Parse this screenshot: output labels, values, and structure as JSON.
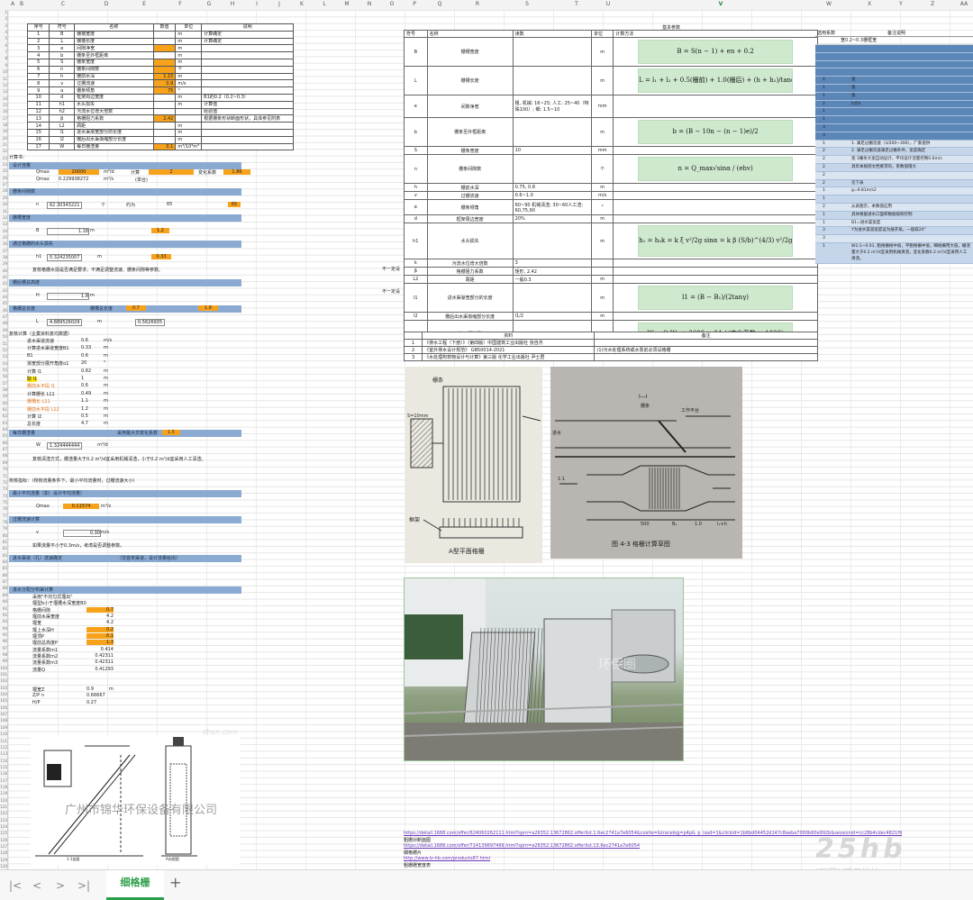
{
  "sheet": {
    "columns": [
      "A",
      "B",
      "C",
      "D",
      "E",
      "F",
      "G",
      "H",
      "I",
      "J",
      "K",
      "L",
      "M",
      "N",
      "O",
      "P",
      "Q",
      "R",
      "S",
      "T",
      "U",
      "V",
      "W",
      "X",
      "Y",
      "Z",
      "AA"
    ],
    "selected_column": "V",
    "active_tab": "细格栅",
    "add_tab": "+"
  },
  "params_table": {
    "headers": [
      "序号",
      "符号",
      "名称",
      "数值",
      "单位",
      "说明"
    ],
    "rows": [
      [
        "1",
        "B",
        "栅槽宽度",
        "",
        "m",
        "计算确定"
      ],
      [
        "2",
        "L",
        "栅槽长度",
        "",
        "m",
        "计算确定"
      ],
      [
        "3",
        "e",
        "间隙净宽",
        "",
        "m",
        ""
      ],
      [
        "4",
        "b",
        "栅条至外框距离",
        "",
        "m",
        ""
      ],
      [
        "5",
        "S",
        "栅条宽度",
        "",
        "m",
        ""
      ],
      [
        "6",
        "n",
        "栅条间隙数",
        "",
        "个",
        ""
      ],
      [
        "7",
        "h",
        "栅前水深",
        "1.15",
        "m",
        ""
      ],
      [
        "8",
        "v",
        "过栅流速",
        "0.9",
        "m/s",
        ""
      ],
      [
        "9",
        "α",
        "栅条倾角",
        "75",
        "°",
        ""
      ],
      [
        "10",
        "d",
        "框架周边宽度",
        "",
        "m",
        "B1的0.2（0.2~0.3）"
      ],
      [
        "11",
        "h1",
        "水头损失",
        "",
        "m",
        "计算值"
      ],
      [
        "12",
        "h2",
        "污流水位增大倍数",
        "",
        "",
        "经验值"
      ],
      [
        "13",
        "β",
        "格栅阻力系数",
        "2.42",
        "",
        "根据栅条形状断面形状，具体参见附表"
      ],
      [
        "14",
        "L2",
        "屑距",
        "",
        "m",
        ""
      ],
      [
        "15",
        "l1",
        "进水渠渐宽部分的长度",
        "",
        "m",
        ""
      ],
      [
        "16",
        "l2",
        "栅后出水渠渐缩部分长度",
        "",
        "m",
        ""
      ],
      [
        "17",
        "W",
        "每日栅渣量",
        "0.1",
        "m³/10³m³",
        ""
      ]
    ]
  },
  "left_calc": {
    "title": "计算书：",
    "s1": "设计流量",
    "q_max_label": "Qmax",
    "q_max_value": "20000",
    "q_max_unit": "m³/d",
    "q_flow_label": "计算",
    "q_flow_value": "2",
    "k_label": "变化系数",
    "k_value": "1.86",
    "q2_label": "Qmax",
    "q2_value": "0.229938272",
    "q2_unit": "m³/s",
    "q2_note": "(单台)",
    "s2": "栅条间隙数",
    "n_label": "n",
    "n_value": "62.30343221",
    "n_unit": "个",
    "n_note": "约为",
    "n_round": "65",
    "n_final": "65",
    "s3": "栅槽宽度",
    "b_label": "B",
    "b_value": "1.18",
    "b_unit": "m",
    "b_round": "1.2",
    "s4": "通过格栅的水头损失",
    "h1_label": "h1",
    "h1_value": "0.324235007",
    "h1_unit": "m",
    "h1_round": "0.33",
    "h1_note": "复核格栅水损是否满足要求，不满足调整流速、栅条间隙等参数。",
    "s5": "栅后槽总高度",
    "H_label": "H",
    "H_value": "1.8",
    "H_unit": "m",
    "s6": "格栅总长度",
    "len_label": "栅槽总长度",
    "len_value1": "0.7",
    "len_value2": "1.8",
    "L_label": "L",
    "L_value": "4.889526029",
    "L_unit": "m",
    "L_value2": "0.5626935"
  },
  "left_calc2": {
    "title": "复核计算（企業资料复均数据）",
    "lines": [
      [
        "进水渠道流速",
        "0.6",
        "m/s"
      ],
      [
        "计算进水渠道宽度B1",
        "0.33",
        "m"
      ],
      [
        "B1",
        "0.6",
        "m"
      ],
      [
        "渐宽部分展开角度α1",
        "20",
        "°"
      ],
      [
        "计算 l1",
        "0.82",
        "m"
      ],
      [
        "取 l1",
        "1",
        "m"
      ],
      [
        "栅前水平段 l1",
        "0.6",
        "m"
      ],
      [
        "计算栅长 L11",
        "0.49",
        "m"
      ],
      [
        "栅槽长 L11",
        "1.1",
        "m"
      ],
      [
        "栅前水平段 L12",
        "1.2",
        "m"
      ],
      [
        "计算 l2",
        "0.5",
        "m"
      ],
      [
        "总长度",
        "4.7",
        "m"
      ]
    ],
    "s7": "每日栅渣量",
    "w_label": "W",
    "w_value": "1.324444444",
    "w_unit": "m³/d",
    "w_note": "采用最大日变化系数",
    "w_k": "1.5",
    "w_text": "复核清渣方式，栅渣量大于0.2 m³/d宜采用机械清渣，小于0.2 m³/d宜采用人工清渣。",
    "check_text": "校核指标：（校核流量条件下，最小平均流量时，过栅流速大小）",
    "s8": "最小平均流量（如：设计平均流量）",
    "qmin_label": "Qmax",
    "qmin_value": "0.11574",
    "qmin_unit": "m³/s",
    "s9": "过栅流速计算",
    "v_label": "v",
    "v_value": "0.30",
    "v_unit": "m/s",
    "v_note": "如果流量不小于0.3m/s，考虑是否调整参数。",
    "s10": "进水渠道（孔）流速确定",
    "s10_note": "（非首末渠道，设计流量给出）",
    "s11": "进水分配分布渠计算",
    "s11_lines": [
      [
        "采用\"不均匀式堰出\"",
        ""
      ],
      [
        "堰型b小于堰槽水深宽度B0",
        ""
      ],
      [
        "格栅间隙",
        "0.7"
      ],
      [
        "堰前水渠宽度",
        "4.2"
      ],
      [
        "堰宽",
        "4.2"
      ],
      [
        "堰上水深H",
        "0.2"
      ],
      [
        "堰顶P",
        "0.1"
      ],
      [
        "堰前总高度P",
        "1.3"
      ],
      [
        "流量系数m1",
        "0.414"
      ],
      [
        "流量系数m2",
        "0.42311"
      ],
      [
        "流量系数m3",
        "0.42311"
      ],
      [
        "流量Q",
        "0.41293"
      ]
    ],
    "end_lines": [
      [
        "堰宽Z",
        "0.9",
        "m"
      ],
      [
        "Z/P n",
        "0.66667",
        ""
      ],
      [
        "H/P",
        "0.27",
        ""
      ]
    ]
  },
  "basic_params": {
    "title": "基本参数",
    "headers": [
      "符号",
      "名称",
      "读数",
      "单位",
      "计算方法"
    ],
    "rows": [
      {
        "sym": "B",
        "name": "栅槽宽度",
        "val": "",
        "unit": "m",
        "formula": "B = S(n − 1) + en + 0.2"
      },
      {
        "sym": "L",
        "name": "栅槽长度",
        "val": "",
        "unit": "m",
        "formula": "L = l₁ + l₂ + 0.5(栅前) + 1.0(栅后) + (h + h₂)/tanα"
      },
      {
        "sym": "e",
        "name": "间隙净宽",
        "val": "粗, 机械: 16~25; 人工: 25~40（特殊100）; 细: 1.5~10",
        "unit": "mm",
        "formula": ""
      },
      {
        "sym": "b",
        "name": "栅条至外框距离",
        "val": "",
        "unit": "m",
        "formula": "b = (B − 10n − (n − 1)e)/2"
      },
      {
        "sym": "S",
        "name": "栅条宽度",
        "val": "10",
        "unit": "mm",
        "formula": ""
      },
      {
        "sym": "n",
        "name": "栅条间隙数",
        "val": "",
        "unit": "个",
        "formula": "n = Q_max√sinα / (ehv)"
      },
      {
        "sym": "h",
        "name": "栅前水深",
        "val": "0.75, 0.8",
        "unit": "m",
        "formula": ""
      },
      {
        "sym": "v",
        "name": "过栅流速",
        "val": "0.6~1.0",
        "unit": "m/s",
        "formula": ""
      },
      {
        "sym": "α",
        "name": "栅条倾角",
        "val": "60~90 机械清渣; 30~60人工渣; 60,75,90",
        "unit": "°",
        "formula": ""
      },
      {
        "sym": "d",
        "name": "框架周边宽度",
        "val": "20%",
        "unit": "m",
        "formula": ""
      },
      {
        "sym": "h1",
        "name": "水头损失",
        "val": "",
        "unit": "m",
        "formula": "h₁ = h₀k = k ξ v²/2g sinα = k β (S/b)^(4/3) v²/2g sinα"
      },
      {
        "sym": "k",
        "name": "污流水位增大倍数",
        "val": "3",
        "unit": "",
        "formula": ""
      },
      {
        "sym": "β",
        "name": "格栅阻力系数",
        "val": "矩形, 2.42",
        "unit": "",
        "formula": ""
      },
      {
        "sym": "L2",
        "name": "屑距",
        "val": "一般0.3",
        "unit": "m",
        "formula": ""
      },
      {
        "sym": "l1",
        "name": "进水渠渐宽部分的长度",
        "val": "",
        "unit": "m",
        "formula": "l1 = (B − B₁)/(2tanγ)"
      },
      {
        "sym": "l2",
        "name": "栅后出水渠渐缩部分长度",
        "val": "l1/2",
        "unit": "m",
        "formula": ""
      },
      {
        "sym": "W",
        "name": "每日栅渣量",
        "val": "",
        "unit": "m³/d",
        "formula": "W = Q W₁ × 3600 × 24 / (变化系数 × 1000)"
      }
    ],
    "side_notes": [
      "不一定设",
      "不一定设"
    ]
  },
  "right_notes": {
    "headers": [
      "选用系数",
      "备注说明"
    ],
    "first": "宽0.2~0.3栅框宽",
    "vals": [
      "2",
      "2",
      "2",
      "2",
      "2",
      "1",
      "1",
      "2",
      "1",
      "1",
      "3",
      "3",
      "1"
    ],
    "notes": [
      "",
      "",
      "",
      "",
      "宽",
      "宽",
      "宽",
      "b大b",
      "",
      "",
      "",
      "",
      "1. 满足过栅流速（3/200~300），厂家提供",
      "2. 满足过栅流速满足过栅条件，宽度确定",
      "宽 1栅条大宽自动设计，平均设计流量控制0.6m/s",
      "具有本规则文档要求的，系数值增大",
      "",
      "见下表",
      "g=9.81m/s2",
      "",
      "从表图示，本数值应用",
      "具体根据进水口面积数据按照控制",
      "B1=进水渠宽度",
      "Y为进水渠道宽度设为展开角，一般取20°",
      "",
      "W1:1~0.01, 粗格栅格中值，平粗格栅中值，细格栅用大值，栅渣量大于0.2 m³/d宜采用机械清渣，变化系数0.2 m³/d宜采用人工清渣。"
    ]
  },
  "refs_table": {
    "headers": [
      "资料",
      "备注"
    ],
    "rows": [
      [
        "1",
        "《排水工程（下册）》（第四版）中国建筑工业出版社 张自杰",
        ""
      ],
      [
        "2",
        "《室外排水设计规范》 GB50014-2021",
        "(1)污水处理系统或水泵前必须设格栅"
      ],
      [
        "3",
        "《水处理构筑物设计与计算》第三版 化学工业出版社 尹士君",
        ""
      ]
    ]
  },
  "figures": {
    "fig_a_caption": "A型平面格栅",
    "fig_a_labels": [
      "栅条",
      "S=10mm",
      "框架"
    ],
    "fig_b_caption": "图 4-3   格栅计算草图",
    "fig_b_labels": [
      "I—I",
      "工作平台",
      "栅条",
      "进水",
      "1:1",
      "500",
      "B₁",
      "1.0",
      "l₁+h"
    ],
    "photo_watermark": "环保圈",
    "drawing_company": "广州市锦华环保设备有限公司",
    "drawing_label1": "1-1剖面",
    "drawing_label2": "A向视图",
    "drawing_watermark": "zhan.com"
  },
  "links": [
    "https://detail.1688.com/offer/624060262111.html?spm=a26352.13672862.offerlist.1.6ec2741a7e6054&cosite=&tracelog=p4p&_p_isad=1&clickid=1b6bd04452d147c8aeba7000b60e992b&sessionid=cc28b4cdec4821f9",
    "粗栅对断面图",
    "https://detail.1688.com/offer/714139697499.html?spm=a26352.13672862.offerlist.13.6ec2741a7e6054",
    "细格栅片",
    "http://www.lz-hb.com/products87.html",
    "粗栅栅宽度表"
  ],
  "site_watermark": {
    "big": "25hb",
    "small": "[碳圈] 环保学社·com"
  }
}
